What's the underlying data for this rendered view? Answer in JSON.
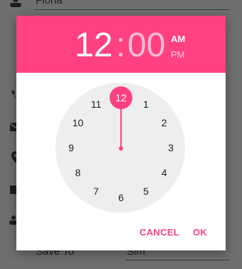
{
  "background_form": {
    "name_value": "Fiona",
    "save_to_label": "Save To",
    "save_to_value": "Sim"
  },
  "time_picker": {
    "hour": "12",
    "colon": ":",
    "minute": "00",
    "am_label": "AM",
    "pm_label": "PM",
    "selected_period": "AM",
    "selected_hour": "12",
    "clock_numbers": [
      "12",
      "1",
      "2",
      "3",
      "4",
      "5",
      "6",
      "7",
      "8",
      "9",
      "10",
      "11"
    ],
    "accent_color": "#ff4081"
  },
  "buttons": {
    "cancel_label": "CANCEL",
    "ok_label": "OK"
  }
}
